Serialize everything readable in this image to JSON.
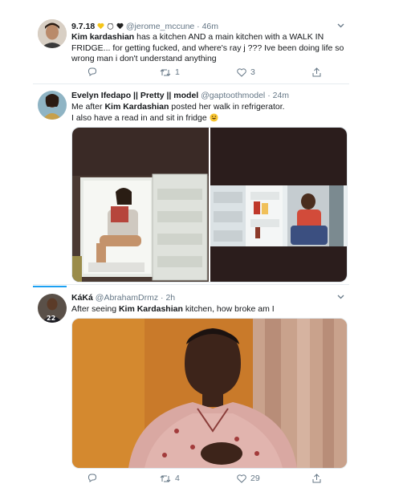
{
  "tweets": [
    {
      "name": "9.7.18",
      "name_emojis": [
        "yellow-heart",
        "cat-face",
        "black-heart"
      ],
      "handle": "@jerome_mccune",
      "time": "· 46m",
      "text_lead": "Kim kardashian",
      "text_rest": " has a kitchen AND a main kitchen with a WALK IN FRIDGE... for getting fucked, and where's ray j ??? Ive been doing life so wrong man i don't understand anything",
      "retweets": "1",
      "likes": "3"
    },
    {
      "name": "Evelyn Ifedapo || Pretty || model",
      "handle": "@gaptoothmodel",
      "time": "· 24m",
      "text_pre": "Me after ",
      "text_bold": "Kim Kardashian",
      "text_post": " posted her walk in refrigerator.",
      "text_line2": "I also have a read in and sit in fridge"
    },
    {
      "name": "KáKá",
      "handle": "@AbrahamDrmz",
      "time": "· 2h",
      "text_pre": "After seeing ",
      "text_bold": "Kim Kardashian",
      "text_post": " kitchen, how broke am I",
      "retweets": "4",
      "likes": "29"
    }
  ],
  "icons": {
    "chevron": "chevron-down-icon",
    "reply": "reply-icon",
    "retweet": "retweet-icon",
    "like": "heart-icon",
    "share": "share-icon",
    "smile": "grinning-emoji"
  },
  "colors": {
    "text": "#14171a",
    "muted": "#657786",
    "accent": "#1da1f2",
    "divider": "#e6ecf0"
  }
}
